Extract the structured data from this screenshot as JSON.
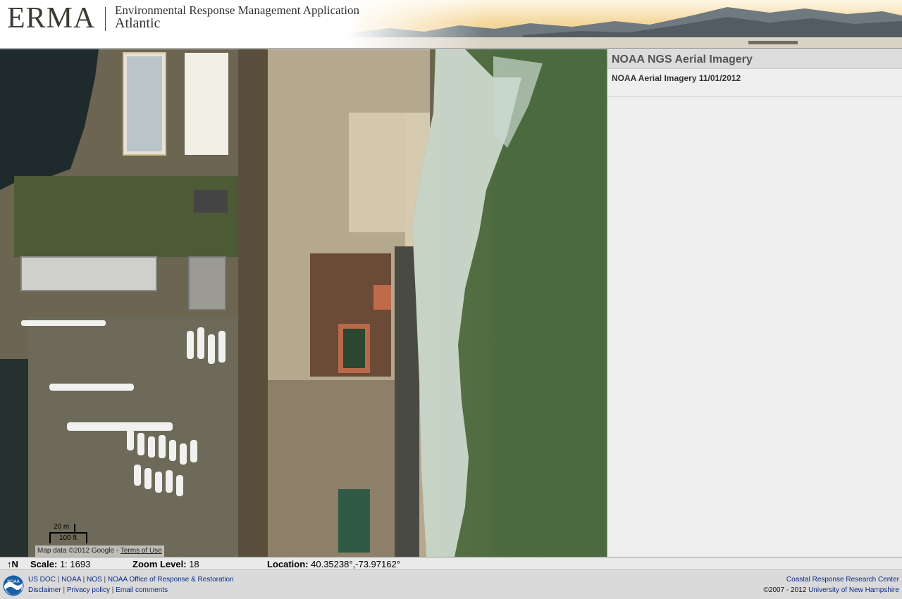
{
  "header": {
    "logo_text": "ERMA",
    "app_name": "Environmental Response Management Application",
    "region": "Atlantic"
  },
  "map": {
    "scale_bar_metric": "20 m",
    "scale_bar_imperial": "100 ft",
    "attribution": "Map data ©2012 Google -",
    "terms_link": "Terms of Use"
  },
  "sidebar": {
    "layer_group_title": "NOAA NGS Aerial Imagery",
    "layer_item": "NOAA Aerial Imagery 11/01/2012"
  },
  "status": {
    "north_label": "N",
    "scale_label": "Scale:",
    "scale_value": "1: 1693",
    "zoom_label": "Zoom Level:",
    "zoom_value": "18",
    "location_label": "Location:",
    "location_value": "40.35238°,-73.97162°"
  },
  "footer": {
    "links_row1": [
      "US DOC",
      "NOAA",
      "NOS",
      "NOAA Office of Response & Restoration"
    ],
    "links_row2": [
      "Disclaimer",
      "Privacy policy",
      "Email comments"
    ],
    "crrc_link": "Coastal Response Research Center",
    "copyright_text": "©2007 - 2012",
    "university_link": "University of New Hampshire",
    "noaa_logo_text": "NOAA"
  },
  "colors": {
    "ocean": "#4f6b3e",
    "sand": "#b8ab92",
    "link": "#0a2a8a"
  }
}
